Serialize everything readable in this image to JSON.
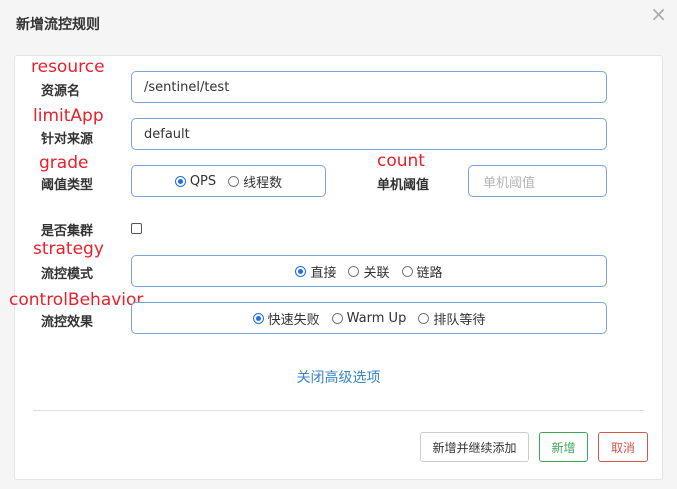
{
  "dialog": {
    "title": "新增流控规则",
    "close_glyph": "×"
  },
  "annotations": {
    "resource": "resource",
    "limitApp": "limitApp",
    "grade": "grade",
    "count": "count",
    "strategy": "strategy",
    "controlBehavior": "controlBehavior"
  },
  "form": {
    "resource": {
      "label": "资源名",
      "value": "/sentinel/test"
    },
    "limit_app": {
      "label": "针对来源",
      "value": "default"
    },
    "grade": {
      "label": "阈值类型",
      "options": [
        "QPS",
        "线程数"
      ],
      "selected": "QPS"
    },
    "count": {
      "label": "单机阈值",
      "value": "",
      "placeholder": "单机阈值"
    },
    "cluster": {
      "label": "是否集群",
      "checked": false
    },
    "strategy": {
      "label": "流控模式",
      "options": [
        "直接",
        "关联",
        "链路"
      ],
      "selected": "直接"
    },
    "control_behavior": {
      "label": "流控效果",
      "options": [
        "快速失败",
        "Warm Up",
        "排队等待"
      ],
      "selected": "快速失败"
    }
  },
  "advanced_link": "关闭高级选项",
  "footer": {
    "add_continue_label": "新增并继续添加",
    "add_label": "新增",
    "cancel_label": "取消"
  },
  "colors": {
    "accent_blue": "#1f6fdc",
    "annotation_red": "#e8202a",
    "add_green": "#3aa855",
    "cancel_red": "#d9534f"
  }
}
